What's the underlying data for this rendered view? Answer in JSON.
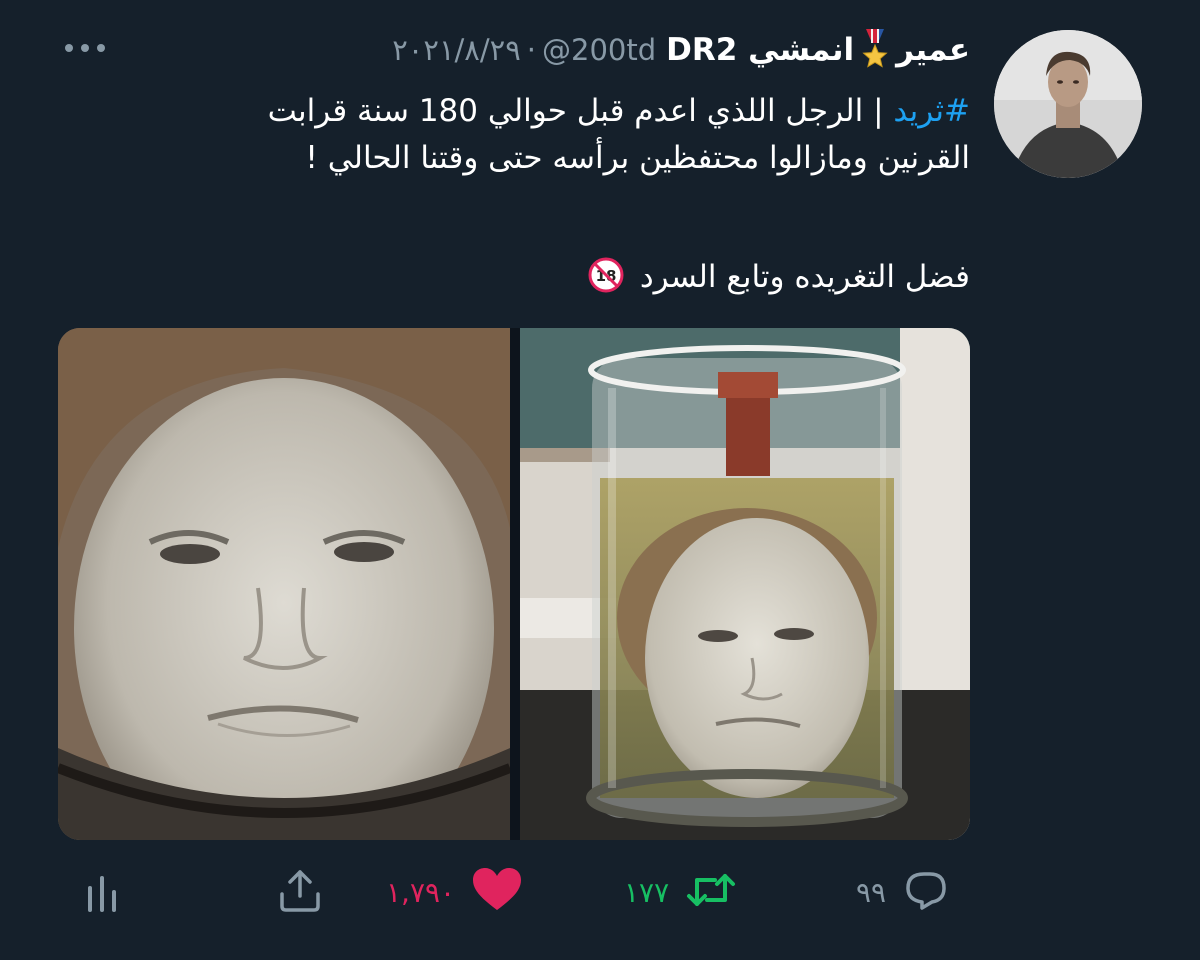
{
  "author": {
    "display_name": "عمير",
    "name_part_2": "انمشي DR2",
    "handle": "@200td",
    "separator": "·",
    "date": "٢٠٢١/٨/٢٩"
  },
  "tweet": {
    "hashtag": "#ثريد",
    "line1_rest": " | الرجل اللذي اعدم قبل حوالي 180 سنة قرابت",
    "line2": "القرنين ومازالوا محتفظين برأسه حتى وقتنا الحالي !",
    "line3": "فضل التغريده وتابع السرد"
  },
  "actions": {
    "reply_count": "٩٩",
    "retweet_count": "١٧٧",
    "like_count": "١,٧٩٠"
  },
  "icons": {
    "more": "more-icon",
    "medal": "medal-icon",
    "no-under-18": "no-under-18-icon",
    "reply": "reply-icon",
    "retweet": "retweet-icon",
    "like": "heart-icon",
    "share": "share-icon",
    "analytics": "analytics-icon"
  },
  "colors": {
    "background": "#15202b",
    "hashtag": "#1da1f2",
    "secondary_text": "#8899a6",
    "retweet_active": "#17bf63",
    "like_active": "#e0245e"
  }
}
